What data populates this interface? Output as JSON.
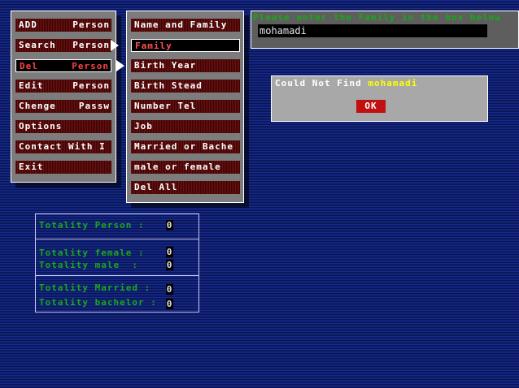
{
  "main_menu": [
    {
      "a": "ADD",
      "b": "Person"
    },
    {
      "a": "Search",
      "b": "Person"
    },
    {
      "a": "Del",
      "b": "Person"
    },
    {
      "a": "Edit",
      "b": "Person"
    },
    {
      "a": "Chenge",
      "b": "Passw"
    },
    {
      "a": "Options",
      "b": ""
    },
    {
      "a": "Contact With I",
      "b": ""
    },
    {
      "a": "Exit",
      "b": ""
    }
  ],
  "sub_menu": [
    "Name and Family",
    "Family",
    "Birth Year",
    "Birth Stead",
    "Number Tel",
    "Job",
    "Married or Bache",
    "male or female",
    "Del All"
  ],
  "input_panel": {
    "prompt": "Please enter the Family in the box below",
    "value": "mohamadi"
  },
  "dialog": {
    "message": "Could Not Find",
    "name": "mohamadi",
    "ok": "OK"
  },
  "stats": {
    "person_label": "Totality Person :",
    "person_value": "0",
    "female_label": "Totality female :",
    "female_value": "0",
    "male_label": "Totality male  :",
    "male_value": "0",
    "married_label": "Totality Married :",
    "married_value": "0",
    "bachelor_label": "Totality bachelor :",
    "bachelor_value": "0"
  },
  "colors": {
    "accent_green": "#1aa81a",
    "button_red": "#5a0a0a",
    "dialog_name": "#ffff00"
  }
}
